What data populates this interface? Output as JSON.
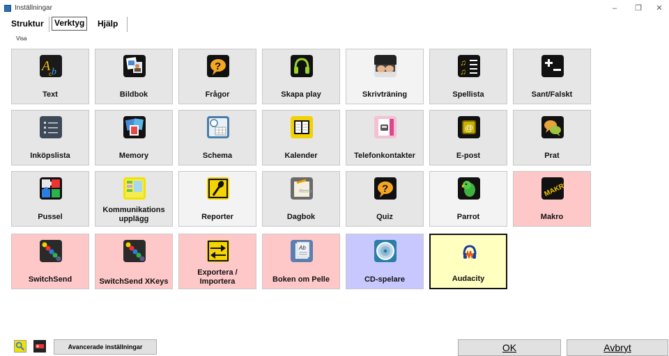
{
  "window": {
    "title": "Inställningar",
    "minimize": "–",
    "restore": "❐",
    "close": "✕"
  },
  "tabs": [
    {
      "label": "Struktur"
    },
    {
      "label": "Verktyg"
    },
    {
      "label": "Hjälp"
    }
  ],
  "section_label": "Visa",
  "tiles": [
    {
      "label": "Text",
      "icon": "text-ab-icon",
      "bg": "#e6e6e6"
    },
    {
      "label": "Bildbok",
      "icon": "picture-book-icon",
      "bg": "#e6e6e6"
    },
    {
      "label": "Frågor",
      "icon": "question-bubble-icon",
      "bg": "#e6e6e6"
    },
    {
      "label": "Skapa play",
      "icon": "headphones-icon",
      "bg": "#e6e6e6"
    },
    {
      "label": "Skrivträning",
      "icon": "typing-hands-icon",
      "bg": "#f3f3f3"
    },
    {
      "label": "Spellista",
      "icon": "playlist-icon",
      "bg": "#e6e6e6"
    },
    {
      "label": "Sant/Falskt",
      "icon": "plus-minus-icon",
      "bg": "#e6e6e6"
    },
    {
      "label": "Inköpslista",
      "icon": "shopping-list-icon",
      "bg": "#e6e6e6"
    },
    {
      "label": "Memory",
      "icon": "memory-cards-icon",
      "bg": "#e6e6e6"
    },
    {
      "label": "Schema",
      "icon": "schedule-icon",
      "bg": "#e6e6e6"
    },
    {
      "label": "Kalender",
      "icon": "calendar-book-icon",
      "bg": "#e6e6e6"
    },
    {
      "label": "Telefonkontakter",
      "icon": "phone-contacts-icon",
      "bg": "#e6e6e6"
    },
    {
      "label": "E-post",
      "icon": "email-at-icon",
      "bg": "#e6e6e6"
    },
    {
      "label": "Prat",
      "icon": "chat-bubbles-icon",
      "bg": "#e6e6e6"
    },
    {
      "label": "Pussel",
      "icon": "puzzle-icon",
      "bg": "#e6e6e6"
    },
    {
      "label": "Kommunikations upplägg",
      "icon": "communication-layout-icon",
      "bg": "#e6e6e6"
    },
    {
      "label": "Reporter",
      "icon": "microphone-icon",
      "bg": "#f3f3f3"
    },
    {
      "label": "Dagbok",
      "icon": "diary-icon",
      "bg": "#e6e6e6"
    },
    {
      "label": "Quiz",
      "icon": "quiz-icon",
      "bg": "#e6e6e6"
    },
    {
      "label": "Parrot",
      "icon": "parrot-icon",
      "bg": "#f3f3f3"
    },
    {
      "label": "Makro",
      "icon": "makro-icon",
      "bg": "#ffc8c8"
    },
    {
      "label": "SwitchSend",
      "icon": "switchsend-dots-icon",
      "bg": "#ffc8c8"
    },
    {
      "label": "SwitchSend XKeys",
      "icon": "switchsend-xkeys-icon",
      "bg": "#ffc8c8"
    },
    {
      "label": "Exportera / Importera",
      "icon": "export-import-arrows-icon",
      "bg": "#ffc8c8"
    },
    {
      "label": "Boken om Pelle",
      "icon": "book-pelle-icon",
      "bg": "#ffc8c8"
    },
    {
      "label": "CD-spelare",
      "icon": "cd-player-icon",
      "bg": "#c8c8ff"
    },
    {
      "label": "Audacity",
      "icon": "audacity-icon",
      "bg": "#ffffc0"
    }
  ],
  "selected_tile": "Audacity",
  "bottom": {
    "advanced_label": "Avancerade inställningar",
    "ok_label": "OK",
    "cancel_label": "Avbryt"
  }
}
